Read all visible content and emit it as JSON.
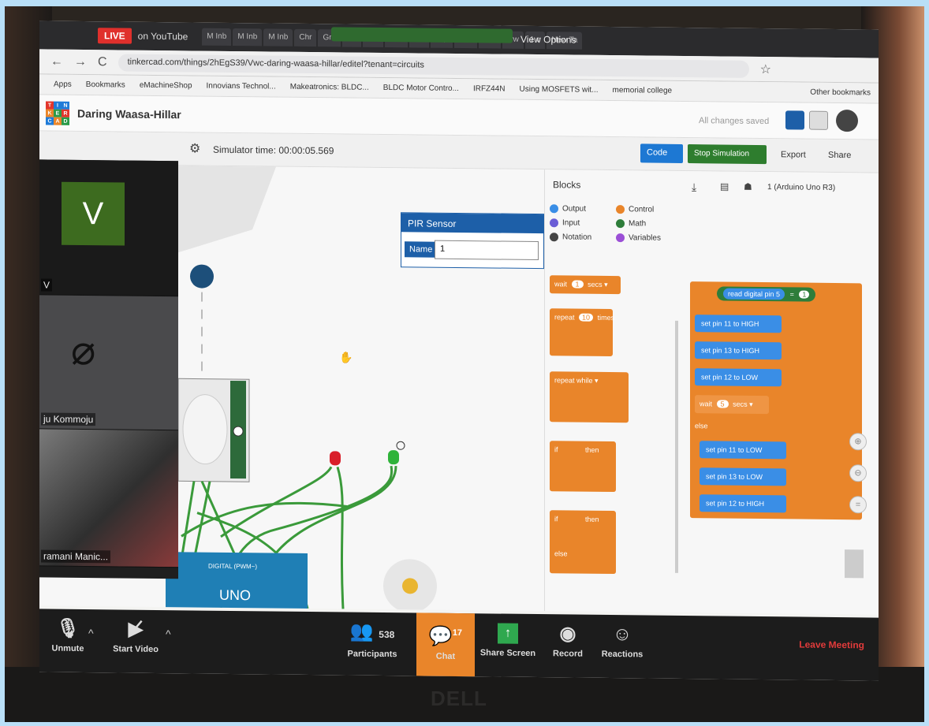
{
  "browser": {
    "live_label": "LIVE",
    "youtube_label": "on YouTube",
    "view_options": "View Options",
    "url": "tinkercad.com/things/2hEgS39/Vwc-daring-waasa-hillar/editel?tenant=circuits",
    "bookmarks": [
      "Apps",
      "Bookmarks",
      "eMachineShop",
      "Innovians Technol...",
      "Makeatronics: BLDC...",
      "BLDC Motor Contro...",
      "IRFZ44N",
      "Using MOSFETS wit...",
      "memorial college",
      "Other bookmarks"
    ]
  },
  "tinkercad": {
    "design_name": "Daring Waasa-Hillar",
    "save_status": "All changes saved",
    "sim_time": "Simulator time: 00:00:05.569",
    "code_label": "Code",
    "stop_label": "Stop Simulation",
    "export_label": "Export",
    "share_label": "Share",
    "pir_title": "PIR Sensor",
    "name_label": "Name",
    "name_value": "1",
    "board_label": "1 (Arduino Uno R3)"
  },
  "blocks": {
    "title": "Blocks",
    "categories": [
      "Output",
      "Control",
      "Input",
      "Math",
      "Notation",
      "Variables"
    ],
    "palette": {
      "wait": "wait",
      "wait_val": "1",
      "secs": "secs",
      "repeat": "repeat",
      "repeat_val": "10",
      "times": "times",
      "repeat_while": "repeat  while",
      "if": "if",
      "then": "then",
      "else": "else"
    },
    "script": {
      "read_pin": "read digital pin  5",
      "eq": "=",
      "val_one": "1",
      "set_rows": [
        "set pin  11  to  HIGH",
        "set pin  13  to  HIGH",
        "set pin  12  to  LOW",
        "set pin  11  to  LOW",
        "set pin  13  to  LOW",
        "set pin  12  to  HIGH"
      ],
      "wait_secs": "wait",
      "wait_val": "5",
      "secs": "secs",
      "else": "else"
    }
  },
  "zoom": {
    "participant_initial": "V",
    "participant_v": "V",
    "participant_2": "ju Kommoju",
    "participant_3": "ramani Manic...",
    "unmute": "Unmute",
    "start_video": "Start Video",
    "participants_count": "538",
    "participants": "Participants",
    "chat_count": "17",
    "chat": "Chat",
    "share_screen": "Share Screen",
    "record": "Record",
    "reactions": "Reactions",
    "leave": "Leave Meeting"
  },
  "board_labels": {
    "uno": "UNO",
    "digital": "DIGITAL (PWM~)"
  },
  "brand": "DELL"
}
